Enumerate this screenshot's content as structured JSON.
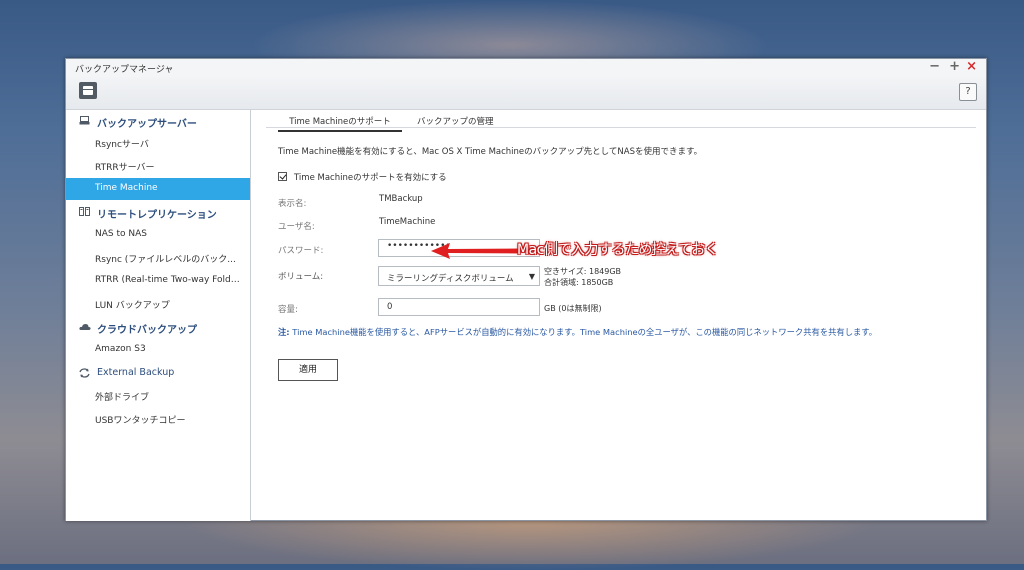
{
  "window": {
    "title": "バックアップマネージャ",
    "controls": {
      "minimize": "−",
      "maximize": "+",
      "close": "×"
    },
    "help": "?"
  },
  "sidebar": {
    "groups": [
      {
        "label": "バックアップサーバー",
        "icon": "server-icon",
        "items": [
          "Rsyncサーバ",
          "RTRRサーバー",
          "Time Machine"
        ]
      },
      {
        "label": "リモートレプリケーション",
        "icon": "replication-icon",
        "items": [
          "NAS to NAS",
          "Rsync (ファイルレベルのバック...",
          "RTRR (Real-time Two-way Folder ...",
          "LUN バックアップ"
        ]
      },
      {
        "label": "クラウドバックアップ",
        "icon": "cloud-icon",
        "items": [
          "Amazon S3"
        ]
      },
      {
        "label": "External Backup",
        "icon": "sync-icon",
        "items": [
          "外部ドライブ",
          "USBワンタッチコピー"
        ]
      }
    ],
    "active_item": "Time Machine"
  },
  "tabs": [
    "Time Machineのサポート",
    "バックアップの管理"
  ],
  "form": {
    "description": "Time Machine機能を有効にすると、Mac OS X Time Machineのバックアップ先としてNASを使用できます。",
    "enable_label": "Time Machineのサポートを有効にする",
    "enable_checked": true,
    "display_name_label": "表示名:",
    "display_name_value": "TMBackup",
    "username_label": "ユーザ名:",
    "username_value": "TimeMachine",
    "password_label": "パスワード:",
    "password_value": "••••••••••••",
    "volume_label": "ボリューム:",
    "volume_value": "ミラーリングディスクボリューム",
    "free_space": "空きサイズ: 1849GB",
    "total_space": "合計領域: 1850GB",
    "capacity_label": "容量:",
    "capacity_value": "0",
    "capacity_unit": "GB (0は無制限)",
    "note_key": "注:",
    "note_text": "Time Machine機能を使用すると、AFPサービスが自動的に有効になります。Time Machineの全ユーザが、この機能の同じネットワーク共有を共有します。",
    "apply_label": "適用"
  },
  "annotation": {
    "text": "Mac側で入力するため控えておく",
    "color": "#e02020"
  }
}
